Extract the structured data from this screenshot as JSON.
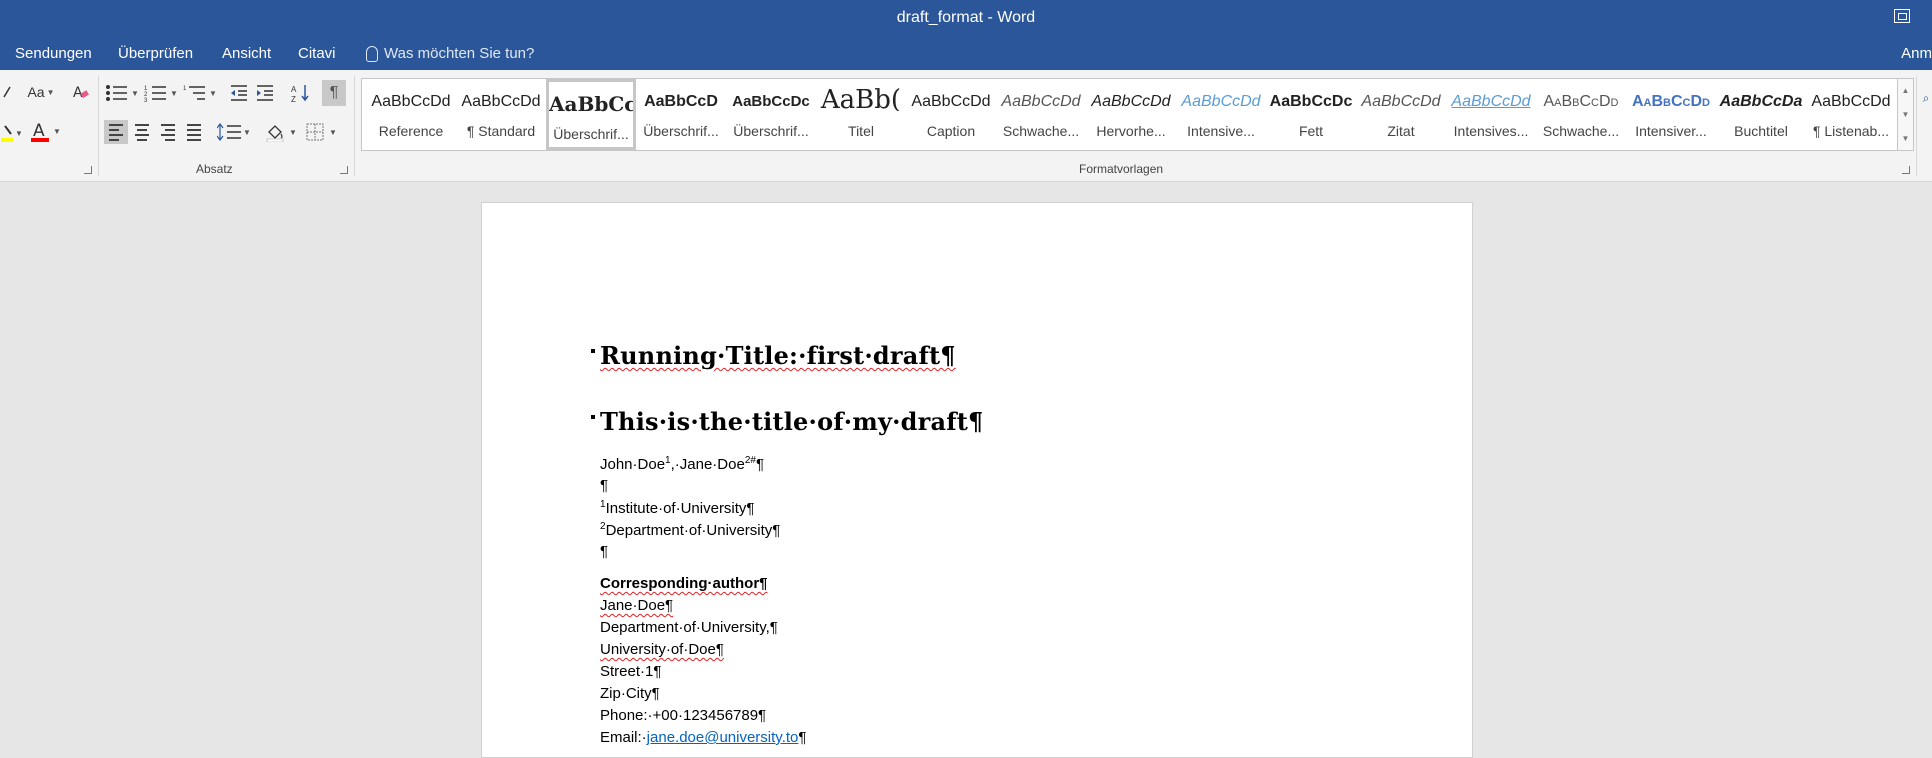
{
  "window": {
    "title": "draft_format - Word"
  },
  "menu": {
    "tabs": [
      "Sendungen",
      "Überprüfen",
      "Ansicht",
      "Citavi"
    ],
    "tell_me": "Was möchten Sie tun?",
    "account": "Anm"
  },
  "ribbon": {
    "font_case_label": "Aa",
    "groups": {
      "paragraph": "Absatz",
      "styles": "Formatvorlagen"
    },
    "styles": [
      {
        "sample": "AaBbCcDd",
        "name": "Reference"
      },
      {
        "sample": "AaBbCcDd",
        "name": "¶ Standard"
      },
      {
        "sample": "AaBbCc",
        "name": "Überschrif..."
      },
      {
        "sample": "AaBbCcD",
        "name": "Überschrif..."
      },
      {
        "sample": "AaBbCcDc",
        "name": "Überschrif..."
      },
      {
        "sample": "AaBb(",
        "name": "Titel"
      },
      {
        "sample": "AaBbCcDd",
        "name": "Caption"
      },
      {
        "sample": "AaBbCcDd",
        "name": "Schwache..."
      },
      {
        "sample": "AaBbCcDd",
        "name": "Hervorhe..."
      },
      {
        "sample": "AaBbCcDd",
        "name": "Intensive..."
      },
      {
        "sample": "AaBbCcDc",
        "name": "Fett"
      },
      {
        "sample": "AaBbCcDd",
        "name": "Zitat"
      },
      {
        "sample": "AaBbCcDd",
        "name": "Intensives..."
      },
      {
        "sample": "AaBbCcDd",
        "name": "Schwache..."
      },
      {
        "sample": "AaBbCcDd",
        "name": "Intensiver..."
      },
      {
        "sample": "AaBbCcDa",
        "name": "Buchtitel"
      },
      {
        "sample": "AaBbCcDd",
        "name": "¶ Listenab..."
      }
    ],
    "selected_style": "Überschrif...",
    "colors": {
      "highlight": "#ffff00",
      "font_color": "#ff0000"
    }
  },
  "document": {
    "running_title": "Running·Title:·first·draft¶",
    "title": "This·is·the·title·of·my·draft¶",
    "authors": {
      "a1": "John·Doe",
      "s1": "1",
      "sep": ",·Jane·Doe",
      "s2": "2#",
      "end": "¶"
    },
    "blank1": "¶",
    "affil1": {
      "sup": "1",
      "text": "Institute·of·University¶"
    },
    "affil2": {
      "sup": "2",
      "text": "Department·of·University¶"
    },
    "blank2": "¶",
    "corresponding": "Corresponding·author¶",
    "contact": [
      "Jane·Doe¶",
      "Department·of·University,¶",
      "University·of·Doe¶",
      "Street·1¶",
      "Zip·City¶",
      "Phone:·+00·123456789¶"
    ],
    "email_label": "Email:·",
    "email": "jane.doe@university.to",
    "email_end": "¶"
  }
}
